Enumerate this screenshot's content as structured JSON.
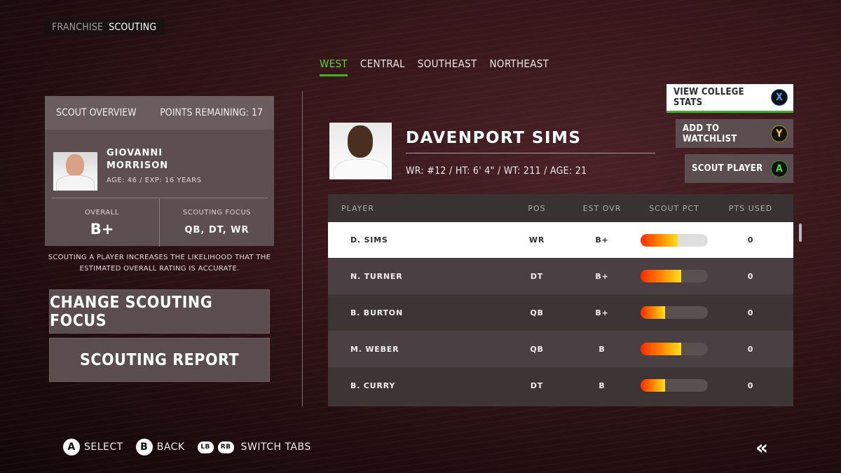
{
  "breadcrumb": {
    "parent": "FRANCHISE",
    "current": "SCOUTING"
  },
  "tabs": [
    {
      "label": "WEST",
      "active": true
    },
    {
      "label": "CENTRAL",
      "active": false
    },
    {
      "label": "SOUTHEAST",
      "active": false
    },
    {
      "label": "NORTHEAST",
      "active": false
    }
  ],
  "overview": {
    "title": "SCOUT OVERVIEW",
    "points_remaining": "POINTS REMAINING: 17",
    "scout_name": "GIOVANNI MORRISON",
    "scout_meta": "AGE: 46  /  EXP: 16 YEARS",
    "overall_label": "OVERALL",
    "overall_value": "B+",
    "focus_label": "SCOUTING FOCUS",
    "focus_value": "QB, DT, WR"
  },
  "note": "SCOUTING A PLAYER INCREASES THE LIKELIHOOD THAT THE ESTIMATED OVERALL RATING IS ACCURATE.",
  "buttons": {
    "change_focus": "CHANGE SCOUTING FOCUS",
    "report": "SCOUTING REPORT",
    "view_stats": "VIEW COLLEGE STATS",
    "view_stats_glyph": "X",
    "watchlist": "ADD TO WATCHLIST",
    "watchlist_glyph": "Y",
    "scout_player": "SCOUT PLAYER",
    "scout_player_glyph": "A"
  },
  "player": {
    "name": "DAVENPORT SIMS",
    "meta": "WR: #12  /  HT: 6' 4\"  /  WT: 211  /  AGE: 21"
  },
  "table": {
    "headers": {
      "player": "PLAYER",
      "pos": "POS",
      "est": "EST OVR",
      "pct": "SCOUT PCT",
      "pts": "PTS USED"
    },
    "rows": [
      {
        "player": "D. SIMS",
        "pos": "WR",
        "est": "B+",
        "pct": 0.55,
        "pts": "0"
      },
      {
        "player": "N. TURNER",
        "pos": "DT",
        "est": "B+",
        "pct": 0.6,
        "pts": "0"
      },
      {
        "player": "B. BURTON",
        "pos": "QB",
        "est": "B+",
        "pct": 0.36,
        "pts": "0"
      },
      {
        "player": "M. WEBER",
        "pos": "QB",
        "est": "B",
        "pct": 0.6,
        "pts": "0"
      },
      {
        "player": "B. CURRY",
        "pos": "DT",
        "est": "B",
        "pct": 0.36,
        "pts": "0"
      }
    ]
  },
  "legend": {
    "select_glyph": "A",
    "select": "SELECT",
    "back_glyph": "B",
    "back": "BACK",
    "lb": "LB",
    "rb": "RB",
    "switch": "SWITCH TABS"
  },
  "icons": {
    "back_arrows": "«"
  }
}
